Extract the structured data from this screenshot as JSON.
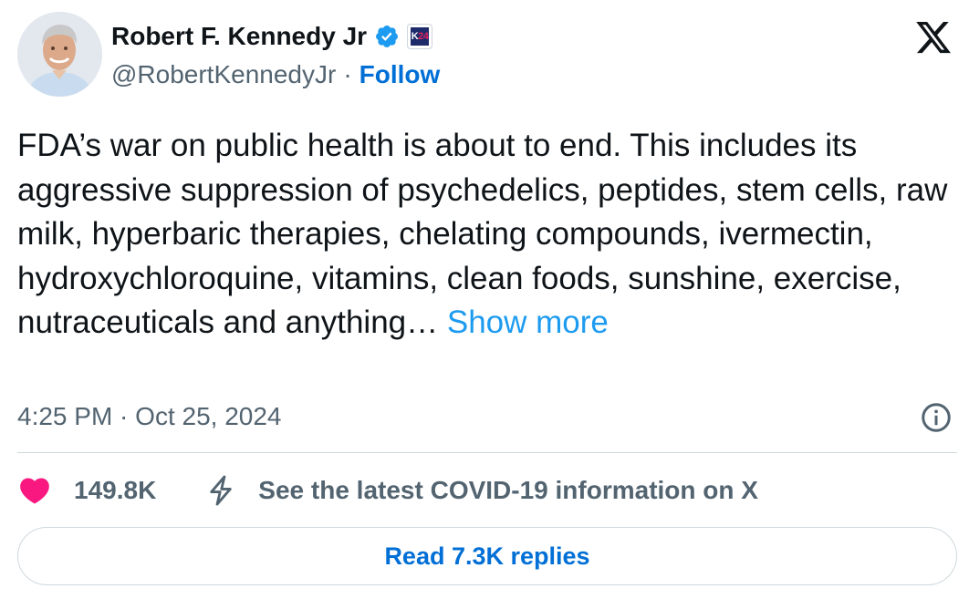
{
  "author": {
    "name": "Robert F. Kennedy Jr",
    "handle": "@RobertKennedyJr",
    "separator": "·",
    "follow_label": "Follow",
    "verified_icon": "verified-badge-icon",
    "affiliate_badge_text": "K24"
  },
  "tweet": {
    "text": "FDA’s war on public health is about to end. This includes its aggressive suppression of psychedelics, peptides, stem cells, raw milk, hyperbaric therapies, chelating compounds, ivermectin, hydroxychloroquine, vitamins, clean foods, sunshine, exercise, nutraceuticals and anything… ",
    "show_more_label": "Show more",
    "timestamp": "4:25 PM · Oct 25, 2024"
  },
  "engagement": {
    "like_count": "149.8K",
    "covid_notice": "See the latest COVID-19 information on X",
    "read_replies_label": "Read 7.3K replies"
  },
  "colors": {
    "text_primary": "#0f1419",
    "text_secondary": "#536471",
    "link": "#1d9bf0",
    "follow": "#006fd6",
    "like": "#f91880",
    "divider": "#cfd9de"
  },
  "icons": [
    "x-logo-icon",
    "info-icon",
    "heart-icon",
    "bolt-icon",
    "verified-badge-icon"
  ]
}
